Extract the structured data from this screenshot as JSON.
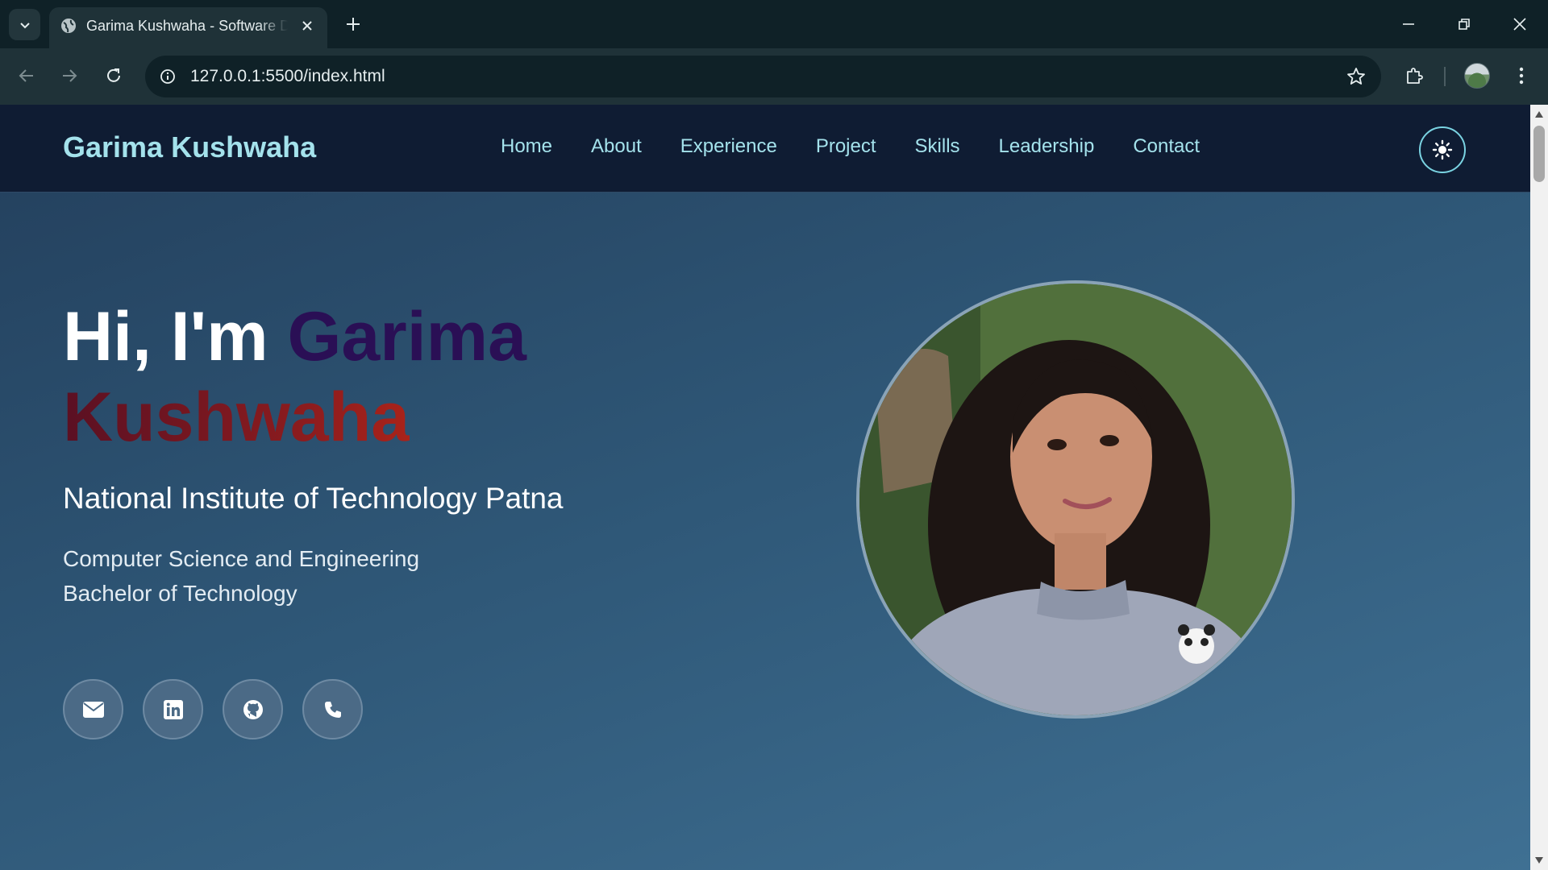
{
  "browser": {
    "tab_title": "Garima Kushwaha - Software Developer",
    "url": "127.0.0.1:5500/index.html"
  },
  "site": {
    "brand": "Garima Kushwaha",
    "nav": [
      "Home",
      "About",
      "Experience",
      "Project",
      "Skills",
      "Leadership",
      "Contact"
    ],
    "theme_toggle_icon": "sun-icon"
  },
  "hero": {
    "greeting": "Hi, I'm",
    "first_name": "Garima",
    "last_name": "Kushwaha",
    "institute": "National Institute of Technology Patna",
    "department": "Computer Science and Engineering",
    "degree": "Bachelor of Technology",
    "social_icons": [
      "envelope-icon",
      "linkedin-icon",
      "github-icon",
      "phone-icon"
    ]
  },
  "colors": {
    "brand_text": "#a4e2ec",
    "nav_bg": "#0f1c33",
    "first_name": "#2a0f55",
    "last_name": "#8c1c1e"
  }
}
